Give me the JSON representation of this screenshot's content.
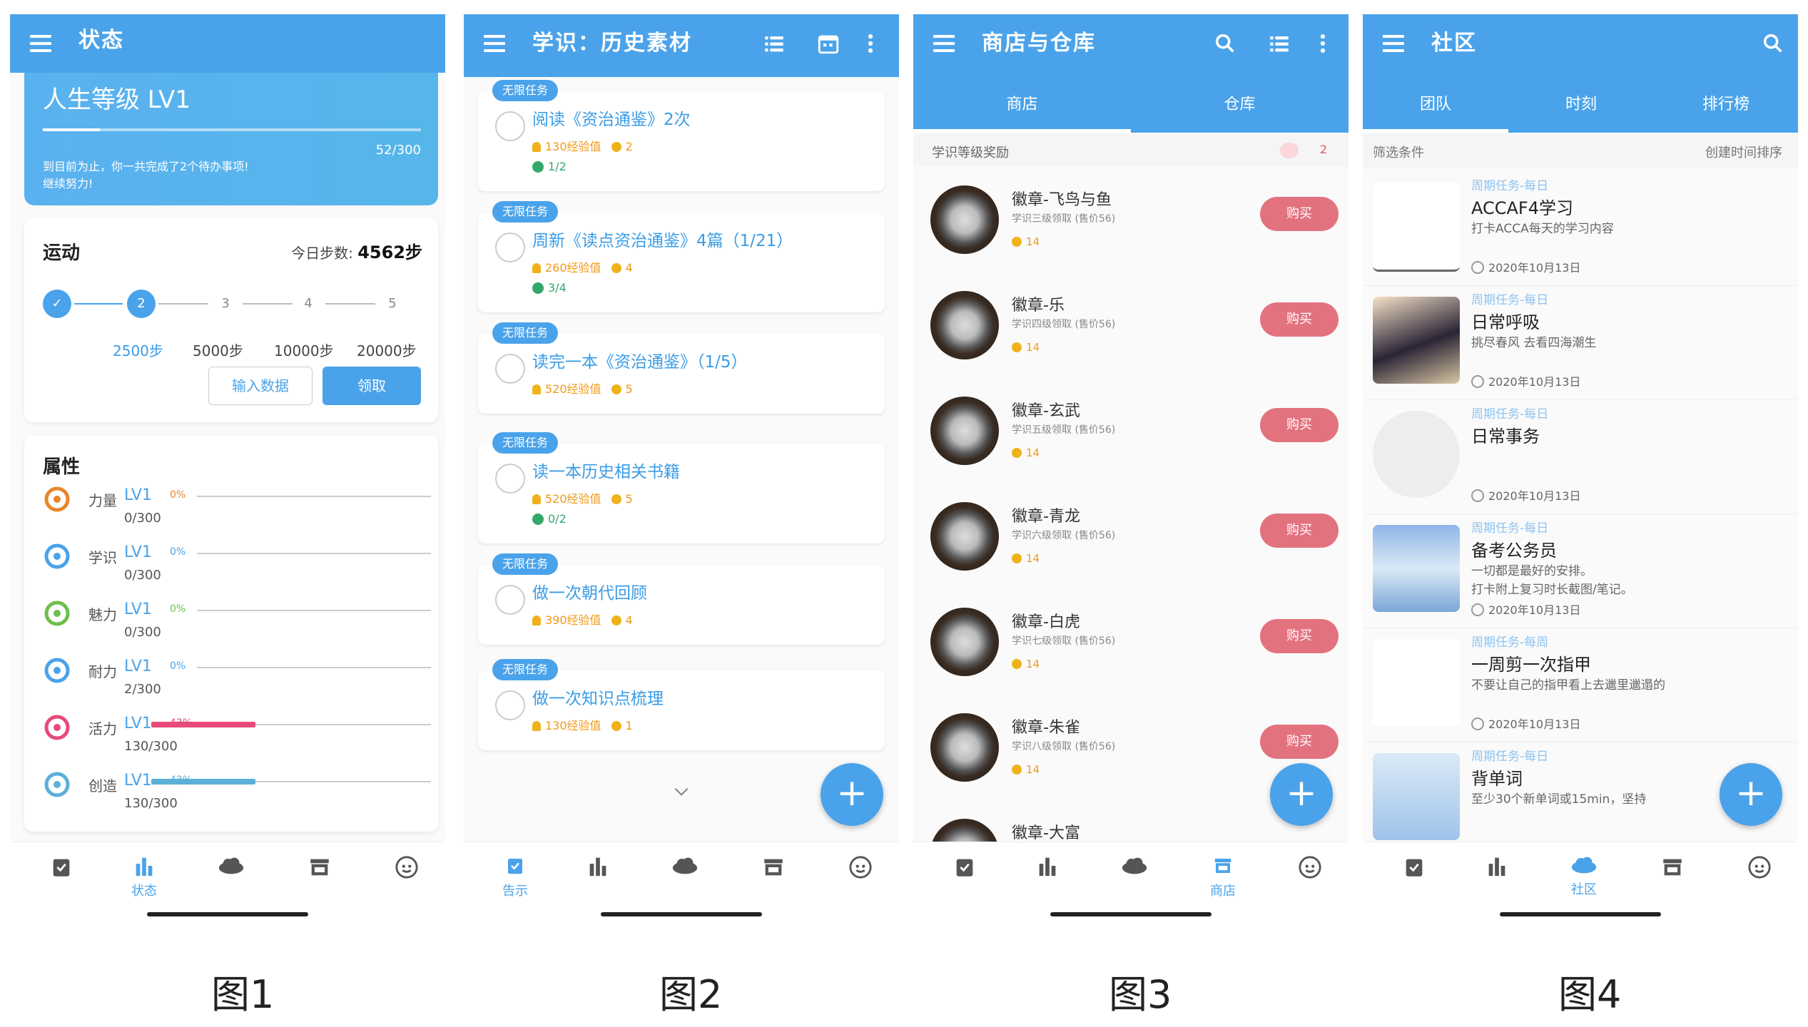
{
  "captions": [
    "图1",
    "图2",
    "图3",
    "图4"
  ],
  "phone1": {
    "title": "状态",
    "level_title": "人生等级 LV1",
    "level_progress": "52/300",
    "level_msg_1": "到目前为止，你一共完成了2个待办事项!",
    "level_msg_2": "继续努力!",
    "steps_title": "运动",
    "steps_today_label": "今日步数:",
    "steps_today_value": "4562步",
    "step_dots": [
      "✓",
      "2",
      "3",
      "4",
      "5"
    ],
    "step_labels": [
      "2500步",
      "5000步",
      "10000步",
      "20000步"
    ],
    "btn_input": "输入数据",
    "btn_claim": "领取",
    "attr_title": "属性",
    "attrs": [
      {
        "name": "力量",
        "lv": "LV1",
        "pct": "0%",
        "val": "0/300",
        "color": "#e8862a",
        "fill": 0
      },
      {
        "name": "学识",
        "lv": "LV1",
        "pct": "0%",
        "val": "0/300",
        "color": "#4aa3ea",
        "fill": 0
      },
      {
        "name": "魅力",
        "lv": "LV1",
        "pct": "0%",
        "val": "0/300",
        "color": "#6cbf4a",
        "fill": 0
      },
      {
        "name": "耐力",
        "lv": "LV1",
        "pct": "0%",
        "val": "2/300",
        "color": "#4aa3ea",
        "fill": 0
      },
      {
        "name": "活力",
        "lv": "LV1",
        "pct": "43%",
        "val": "130/300",
        "color": "#e84a7a",
        "fill": 43
      },
      {
        "name": "创造",
        "lv": "LV1",
        "pct": "43%",
        "val": "130/300",
        "color": "#5bb0d8",
        "fill": 43
      }
    ],
    "nav_label": "状态"
  },
  "phone2": {
    "title": "学识：历史素材",
    "tasks": [
      {
        "tag": "无限任务",
        "name": "阅读《资治通鉴》2次",
        "exp": "130经验值",
        "coin": "2",
        "sub": "1/2"
      },
      {
        "tag": "无限任务",
        "name": "周新《读点资治通鉴》4篇（1/21）",
        "exp": "260经验值",
        "coin": "4",
        "sub": "3/4"
      },
      {
        "tag": "无限任务",
        "name": "读完一本《资治通鉴》（1/5）",
        "exp": "520经验值",
        "coin": "5",
        "sub": ""
      },
      {
        "tag": "无限任务",
        "name": "读一本历史相关书籍",
        "exp": "520经验值",
        "coin": "5",
        "sub": "0/2"
      },
      {
        "tag": "无限任务",
        "name": "做一次朝代回顾",
        "exp": "390经验值",
        "coin": "4",
        "sub": ""
      },
      {
        "tag": "无限任务",
        "name": "做一次知识点梳理",
        "exp": "130经验值",
        "coin": "1",
        "sub": ""
      }
    ],
    "nav_label": "告示"
  },
  "phone3": {
    "title": "商店与仓库",
    "tabs": [
      "商店",
      "仓库"
    ],
    "section": "学识等级奖励",
    "section_count": "2",
    "items": [
      {
        "name": "徽章-飞鸟与鱼",
        "desc": "学识三级领取 (售价56)",
        "price": "14",
        "buy": "购买"
      },
      {
        "name": "徽章-乐",
        "desc": "学识四级领取 (售价56)",
        "price": "14",
        "buy": "购买"
      },
      {
        "name": "徽章-玄武",
        "desc": "学识五级领取 (售价56)",
        "price": "14",
        "buy": "购买"
      },
      {
        "name": "徽章-青龙",
        "desc": "学识六级领取 (售价56)",
        "price": "14",
        "buy": "购买"
      },
      {
        "name": "徽章-白虎",
        "desc": "学识七级领取 (售价56)",
        "price": "14",
        "buy": "购买"
      },
      {
        "name": "徽章-朱雀",
        "desc": "学识八级领取 (售价56)",
        "price": "14",
        "buy": "购买"
      },
      {
        "name": "徽章-大富",
        "desc": "",
        "price": "",
        "buy": ""
      }
    ],
    "nav_label": "商店"
  },
  "phone4": {
    "title": "社区",
    "tabs": [
      "团队",
      "时刻",
      "排行榜"
    ],
    "filter_left": "筛选条件",
    "filter_right": "创建时间排序",
    "items": [
      {
        "period": "周期任务-每日",
        "title": "ACCAF4学习",
        "desc": "打卡ACCA每天的学习内容",
        "desc2": "",
        "date": "2020年10月13日"
      },
      {
        "period": "周期任务-每日",
        "title": "日常呼吸",
        "desc": "挑尽春风 去看四海潮生",
        "desc2": "",
        "date": "2020年10月13日"
      },
      {
        "period": "周期任务-每日",
        "title": "日常事务",
        "desc": "",
        "desc2": "",
        "date": "2020年10月13日"
      },
      {
        "period": "周期任务-每日",
        "title": "备考公务员",
        "desc": "一切都是最好的安排。",
        "desc2": "打卡附上复习时长截图/笔记。",
        "date": "2020年10月13日"
      },
      {
        "period": "周期任务-每周",
        "title": "一周剪一次指甲",
        "desc": "不要让自己的指甲看上去邋里邋遢的",
        "desc2": "",
        "date": "2020年10月13日"
      },
      {
        "period": "周期任务-每日",
        "title": "背单词",
        "desc": "至少30个新单词或15min，坚持",
        "desc2": "",
        "date": ""
      }
    ],
    "nav_label": "社区"
  },
  "colors": {
    "primary": "#4aa3ea",
    "buy": "#e3727f",
    "exp": "#f09a1a"
  }
}
